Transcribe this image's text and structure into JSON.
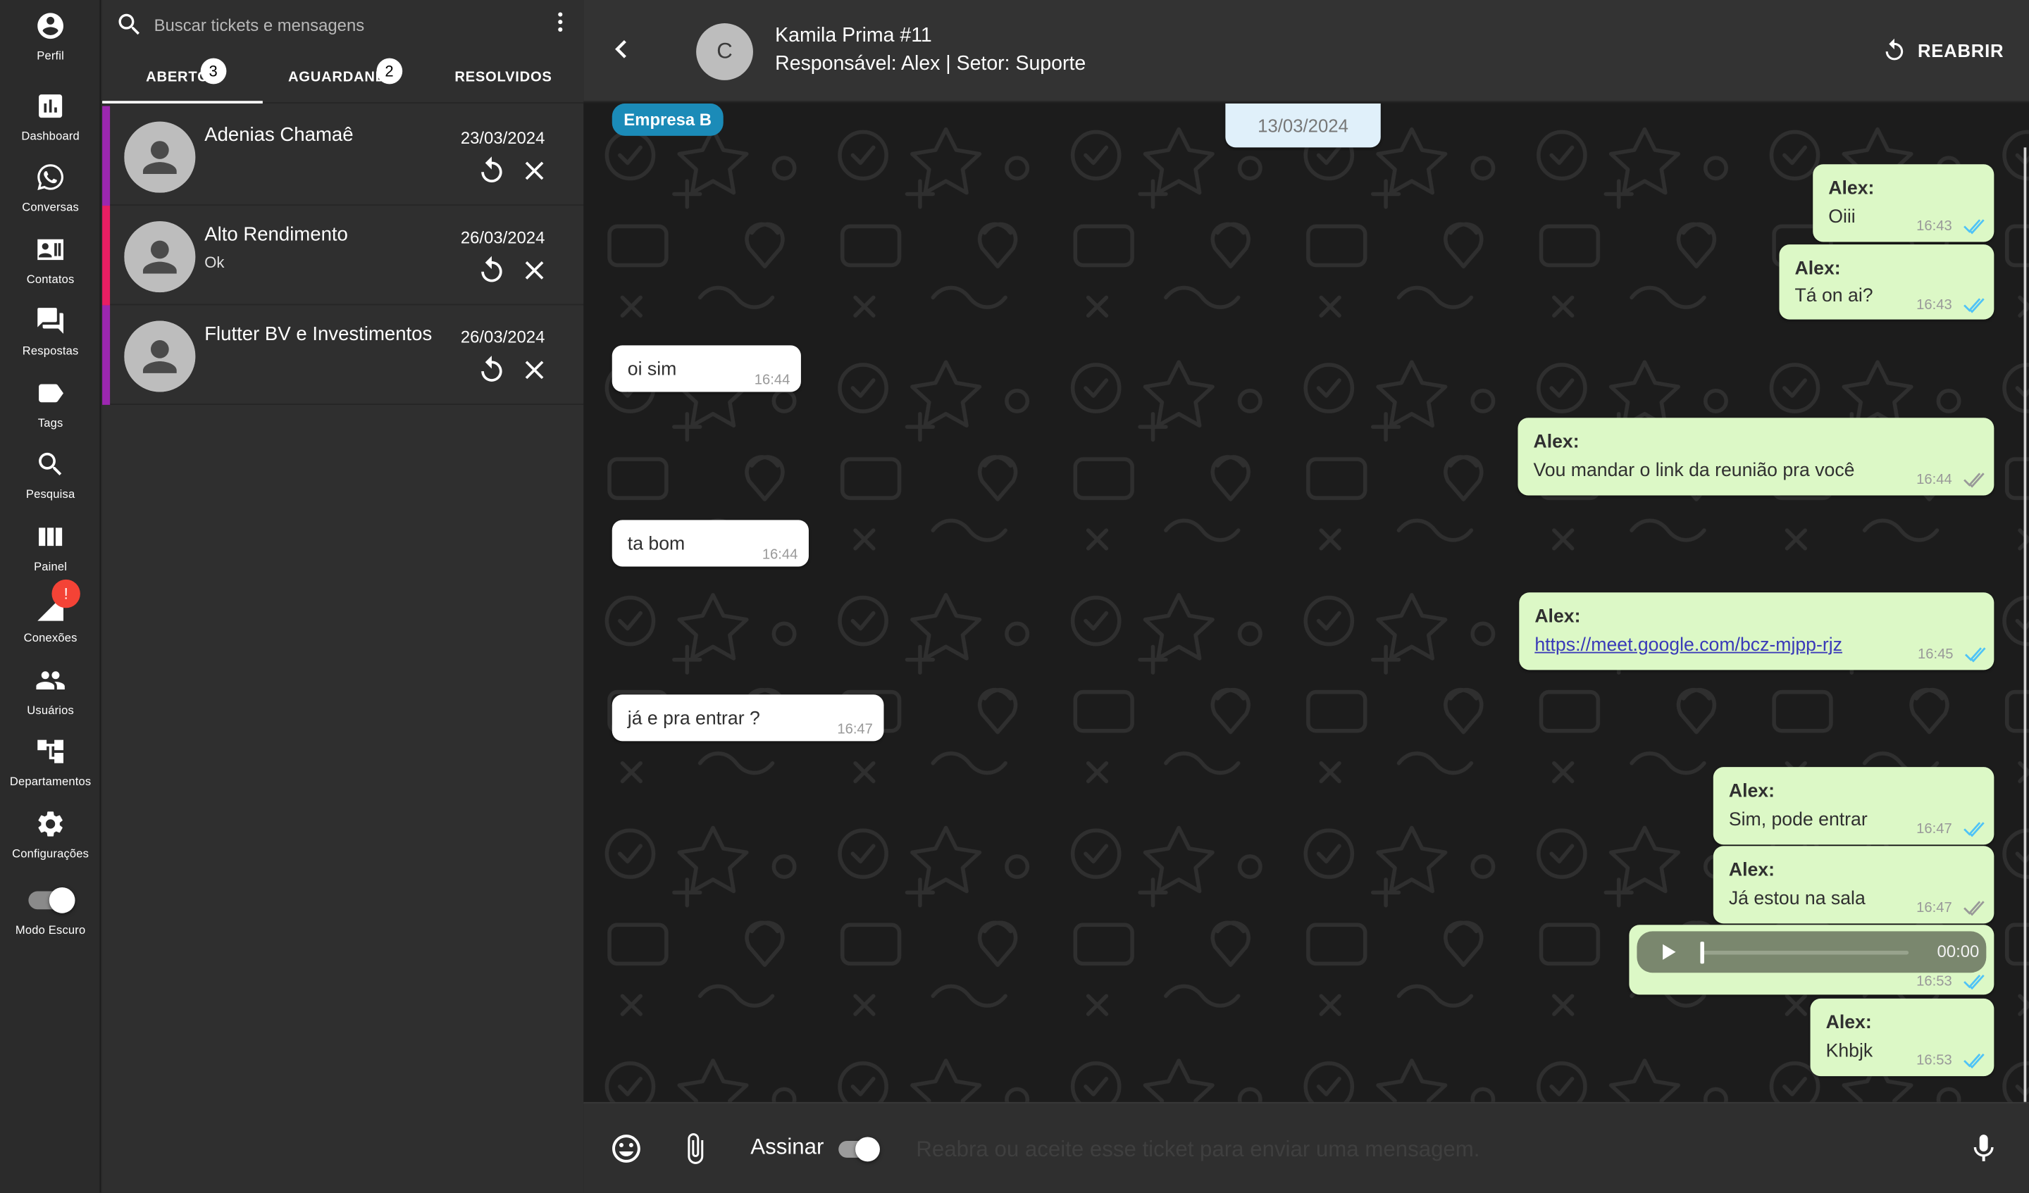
{
  "nav": {
    "items": [
      {
        "label": "Perfil",
        "icon": "account-circle-icon"
      },
      {
        "label": "Dashboard",
        "icon": "bar-chart-icon"
      },
      {
        "label": "Conversas",
        "icon": "whatsapp-icon"
      },
      {
        "label": "Contatos",
        "icon": "contact-card-icon"
      },
      {
        "label": "Respostas",
        "icon": "chat-bubbles-icon"
      },
      {
        "label": "Tags",
        "icon": "tag-icon"
      },
      {
        "label": "Pesquisa",
        "icon": "search-icon"
      },
      {
        "label": "Painel",
        "icon": "kanban-columns-icon"
      },
      {
        "label": "Conexões",
        "icon": "signal-icon",
        "badge": "!"
      },
      {
        "label": "Usuários",
        "icon": "users-icon"
      },
      {
        "label": "Departamentos",
        "icon": "org-tree-icon"
      },
      {
        "label": "Configurações",
        "icon": "gear-icon"
      },
      {
        "label": "Modo Escuro",
        "icon": "toggle-switch-icon"
      }
    ]
  },
  "search": {
    "placeholder": "Buscar tickets e mensagens"
  },
  "tabs": [
    {
      "label": "ABERTOS",
      "badge": "3",
      "active": true
    },
    {
      "label": "AGUARDANDO",
      "badge": "2",
      "active": false
    },
    {
      "label": "RESOLVIDOS",
      "badge": "",
      "active": false
    }
  ],
  "tickets": [
    {
      "name": "Adenias Chamaê",
      "last_message": "",
      "date": "23/03/2024",
      "color": "#9c27b0"
    },
    {
      "name": "Alto Rendimento",
      "last_message": "Ok",
      "date": "26/03/2024",
      "color": "#e91e63"
    },
    {
      "name": "Flutter BV e Investimentos",
      "last_message": "",
      "date": "26/03/2024",
      "color": "#9c27b0"
    }
  ],
  "chat": {
    "avatar_letter": "C",
    "title": "Kamila Prima #11",
    "subtitle": "Responsável: Alex | Setor: Suporte",
    "reopen_label": "REABRIR",
    "tag": "Empresa B",
    "tag_color": "#1b8bb8",
    "date_divider": "13/03/2024",
    "messages": [
      {
        "direction": "out",
        "author": "Alex:",
        "text": "Oiii",
        "time": "16:43",
        "status": "read"
      },
      {
        "direction": "out",
        "author": "Alex:",
        "text": "Tá on ai?",
        "time": "16:43",
        "status": "read"
      },
      {
        "direction": "in",
        "text": "oi sim",
        "time": "16:44"
      },
      {
        "direction": "out",
        "author": "Alex:",
        "text": "Vou mandar o link da reunião pra você",
        "time": "16:44",
        "status": "delivered"
      },
      {
        "direction": "in",
        "text": "ta bom",
        "time": "16:44"
      },
      {
        "direction": "out",
        "author": "Alex:",
        "text": "https://meet.google.com/bcz-mjpp-rjz",
        "time": "16:45",
        "status": "read"
      },
      {
        "direction": "in",
        "text": "já e pra entrar ?",
        "time": "16:47"
      },
      {
        "direction": "out",
        "author": "Alex:",
        "text": "Sim, pode entrar",
        "time": "16:47",
        "status": "read"
      },
      {
        "direction": "out",
        "author": "Alex:",
        "text": "Já estou na sala",
        "time": "16:47",
        "status": "delivered"
      },
      {
        "direction": "out",
        "type": "audio",
        "duration": "00:00",
        "time": "16:53",
        "status": "read"
      },
      {
        "direction": "out",
        "author": "Alex:",
        "text": "Khbjk",
        "time": "16:53",
        "status": "read"
      }
    ],
    "colors": {
      "outgoing": "#dcf8c6",
      "incoming": "#ffffff",
      "read_tick": "#4fc3f7",
      "delivered_tick": "#999999"
    }
  },
  "composer": {
    "sign_label": "Assinar",
    "placeholder": "Reabra ou aceite esse ticket para enviar uma mensagem."
  }
}
